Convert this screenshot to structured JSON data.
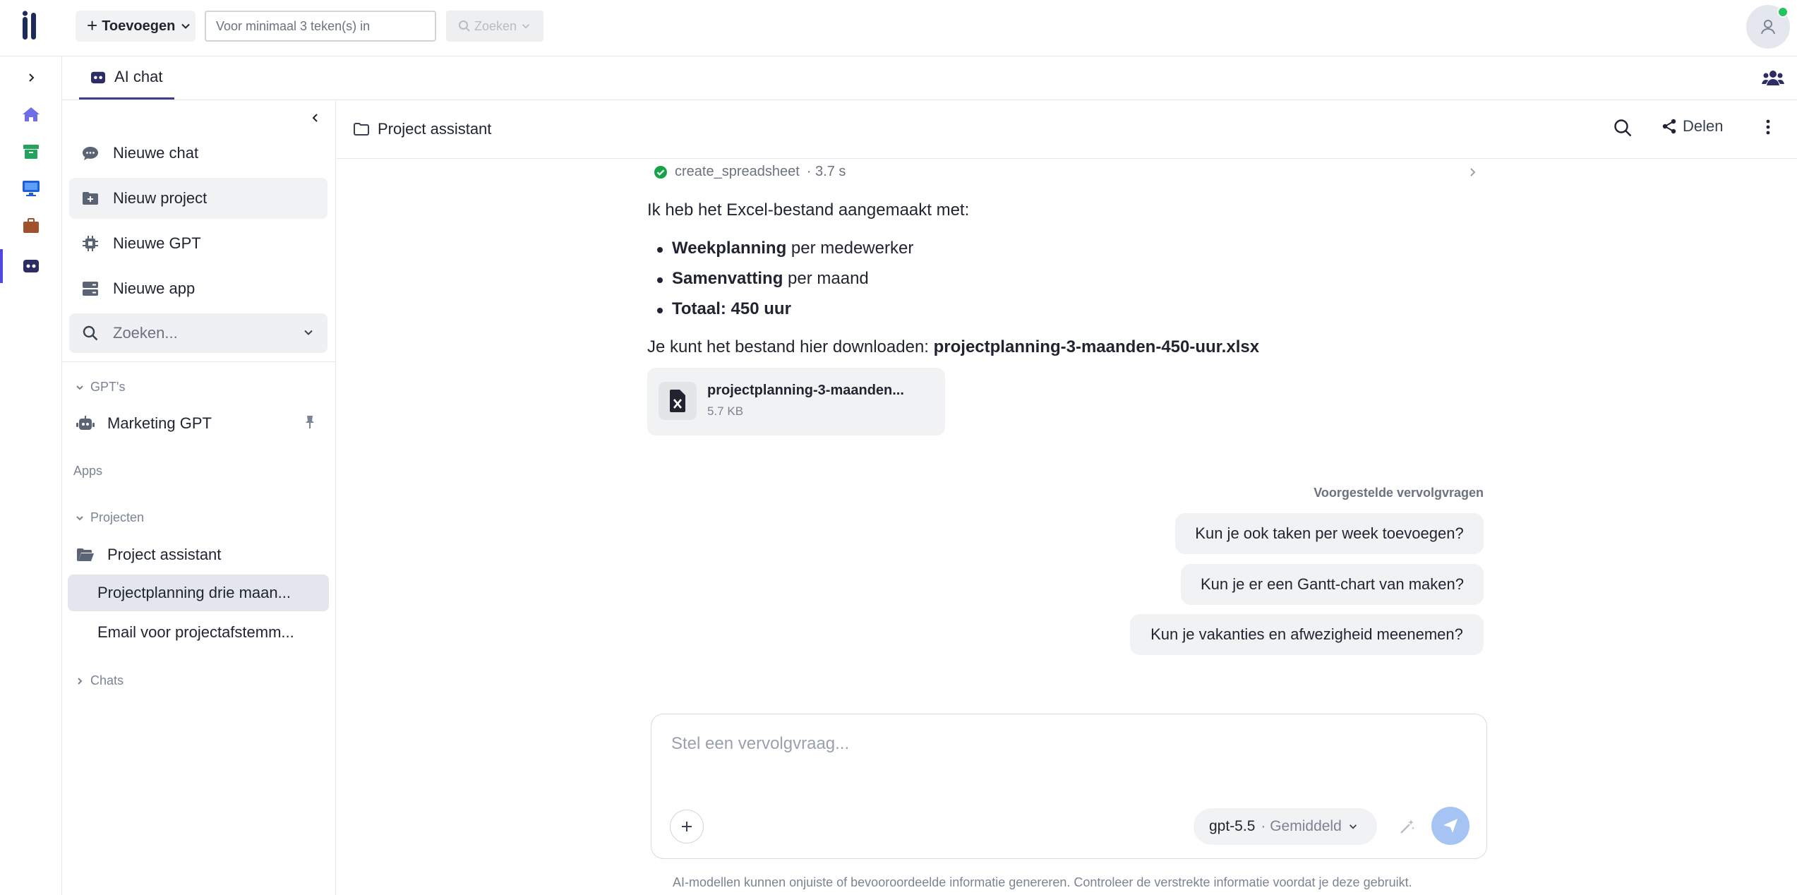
{
  "topbar": {
    "add_label": "Toevoegen",
    "search_placeholder": "Voor minimaal 3 teken(s) in",
    "search_button": "Zoeken"
  },
  "tabs": {
    "active_label": "AI chat"
  },
  "sidebar": {
    "items": [
      {
        "label": "Nieuwe chat",
        "icon": "chat-bubble-icon"
      },
      {
        "label": "Nieuw project",
        "icon": "folder-plus-icon"
      },
      {
        "label": "Nieuwe GPT",
        "icon": "chip-icon"
      },
      {
        "label": "Nieuwe app",
        "icon": "server-icon"
      }
    ],
    "search_placeholder": "Zoeken...",
    "gpts_section": "GPT's",
    "gpt_item": "Marketing GPT",
    "apps_section": "Apps",
    "projects_section": "Projecten",
    "project_name": "Project assistant",
    "project_chats": [
      "Projectplanning drie maan...",
      "Email voor projectafstemm..."
    ],
    "chats_section": "Chats"
  },
  "main": {
    "title": "Project assistant",
    "share_label": "Delen",
    "tool_call": {
      "name": "create_spreadsheet",
      "duration": "· 3.7 s"
    },
    "intro": "Ik heb het Excel-bestand aangemaakt met:",
    "bullets": [
      {
        "bold": "Weekplanning",
        "rest": " per medewerker"
      },
      {
        "bold": "Samenvatting",
        "rest": " per maand"
      },
      {
        "bold": "Totaal: 450 uur",
        "rest": ""
      }
    ],
    "download_prefix": "Je kunt het bestand hier downloaden: ",
    "download_file": "projectplanning-3-maanden-450-uur.xlsx",
    "file_card": {
      "name": "projectplanning-3-maanden...",
      "size": "5.7 KB"
    },
    "suggestions_label": "Voorgestelde vervolgvragen",
    "suggestions": [
      "Kun je ook taken per week toevoegen?",
      "Kun je er een Gantt-chart van maken?",
      "Kun je vakanties en afwezigheid meenemen?"
    ],
    "composer_placeholder": "Stel een vervolgvraag...",
    "model": "gpt-5.5",
    "model_mode": "· Gemiddeld",
    "disclaimer": "AI-modellen kunnen onjuiste of bevooroordeelde informatie genereren. Controleer de verstrekte informatie voordat je deze gebruikt."
  },
  "colors": {
    "accent": "#4f46e5",
    "online": "#22c55e",
    "send": "#a5c4f3"
  }
}
